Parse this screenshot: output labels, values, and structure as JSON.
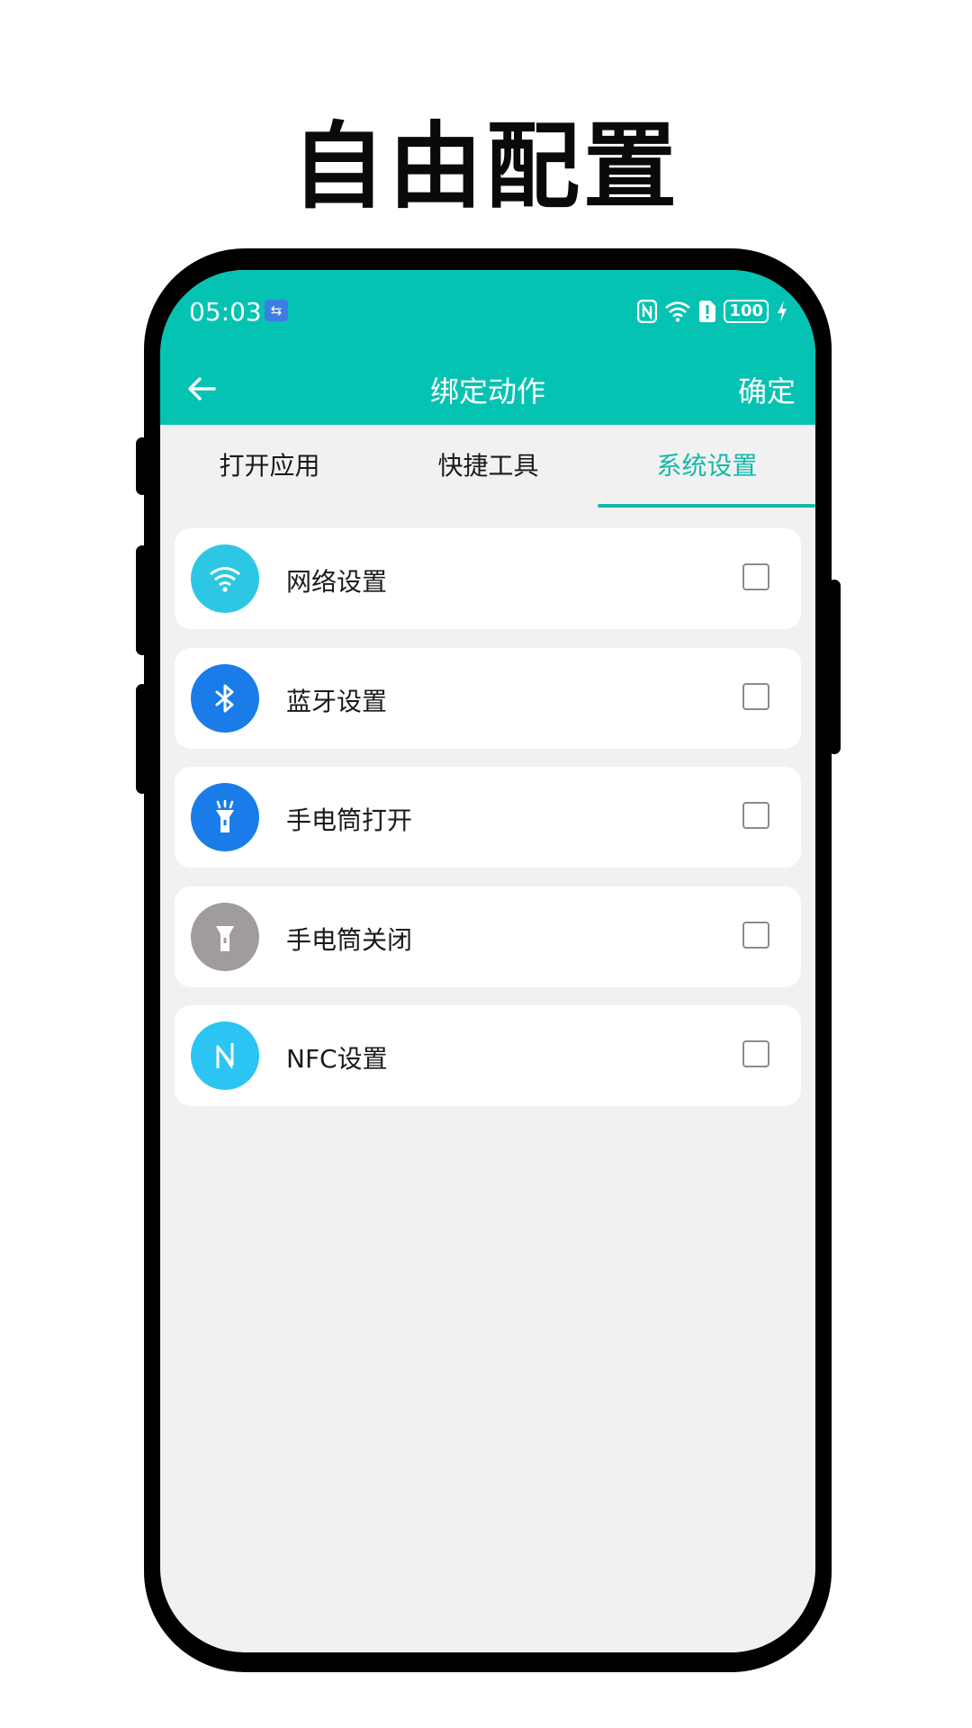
{
  "headline": "自由配置",
  "status_bar": {
    "time": "05:03",
    "battery": "100"
  },
  "app_bar": {
    "title": "绑定动作",
    "confirm_label": "确定"
  },
  "tabs": [
    {
      "label": "打开应用",
      "active": false
    },
    {
      "label": "快捷工具",
      "active": false
    },
    {
      "label": "系统设置",
      "active": true
    }
  ],
  "items": [
    {
      "label": "网络设置",
      "icon": "wifi-icon",
      "color": "#2ec7e3",
      "checked": false
    },
    {
      "label": "蓝牙设置",
      "icon": "bluetooth-icon",
      "color": "#1a7ce8",
      "checked": false
    },
    {
      "label": "手电筒打开",
      "icon": "flashlight-on-icon",
      "color": "#1a7ce8",
      "checked": false
    },
    {
      "label": "手电筒关闭",
      "icon": "flashlight-off-icon",
      "color": "#a09c9c",
      "checked": false
    },
    {
      "label": "NFC设置",
      "icon": "nfc-icon",
      "color": "#2cc4f2",
      "checked": false
    }
  ],
  "colors": {
    "accent": "#05c3b3",
    "tab_active": "#13b9a9"
  }
}
